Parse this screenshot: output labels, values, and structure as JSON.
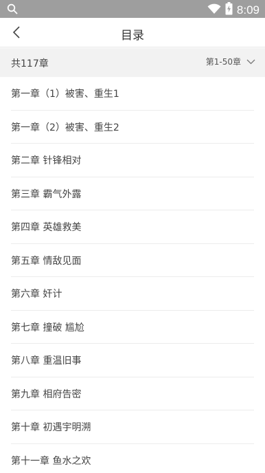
{
  "status_bar": {
    "time": "8:09",
    "icons": [
      "search-icon",
      "wifi-icon",
      "battery-icon"
    ]
  },
  "header": {
    "title": "目录",
    "back_icon": "chevron-left-icon"
  },
  "summary": {
    "total": "共117章",
    "range": "第1-50章",
    "range_icon": "chevron-down-icon"
  },
  "chapters": [
    {
      "label": "第一章（1）被害、重生1"
    },
    {
      "label": "第一章（2）被害、重生2"
    },
    {
      "label": "第二章 针锋相对"
    },
    {
      "label": "第三章 霸气外露"
    },
    {
      "label": "第四章 英雄救美"
    },
    {
      "label": "第五章 情敌见面"
    },
    {
      "label": "第六章 奸计"
    },
    {
      "label": "第七章 撞破 尴尬"
    },
    {
      "label": "第八章 重温旧事"
    },
    {
      "label": "第九章 相府告密"
    },
    {
      "label": "第十章 初遇宇明溯"
    },
    {
      "label": "第十一章 鱼水之欢"
    }
  ]
}
